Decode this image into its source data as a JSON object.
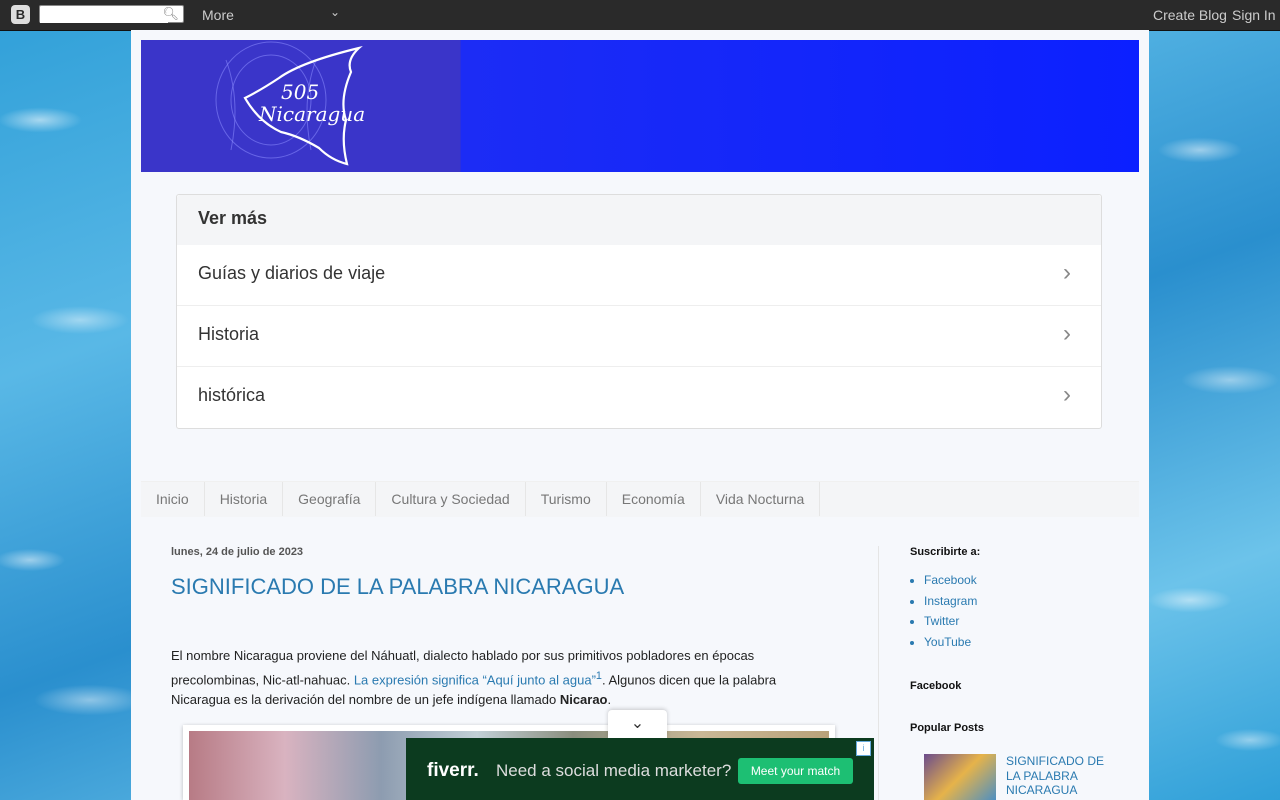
{
  "navbar": {
    "logo_letter": "B",
    "search_placeholder": "",
    "more_label": "More",
    "create_blog": "Create Blog",
    "sign_in": "Sign In"
  },
  "banner": {
    "line1": "505",
    "line2": "Nicaragua",
    "colors": {
      "left": "#3a35c9",
      "right": "#0b20ff"
    }
  },
  "ver_mas": {
    "title": "Ver más",
    "items": [
      {
        "label": "Guías y diarios de viaje"
      },
      {
        "label": "Historia"
      },
      {
        "label": "histórica"
      }
    ]
  },
  "tabs": [
    {
      "label": "Inicio"
    },
    {
      "label": "Historia"
    },
    {
      "label": "Geografía"
    },
    {
      "label": "Cultura y Sociedad"
    },
    {
      "label": "Turismo"
    },
    {
      "label": "Economía"
    },
    {
      "label": "Vida Nocturna"
    }
  ],
  "post": {
    "date": "lunes, 24 de julio de 2023",
    "title": "SIGNIFICADO DE LA PALABRA NICARAGUA",
    "body_part1": " El nombre Nicaragua proviene del Náhuatl, dialecto hablado por sus primitivos pobladores en épocas precolombinas, Nic-atl-nahuac. ",
    "body_link": "La expresión significa “Aquí junto al agua”",
    "body_sup": "1",
    "body_part2": ". Algunos dicen que la palabra Nicaragua es la derivación del nombre de un jefe indígena llamado ",
    "body_bold": "Nicarao",
    "body_end": "."
  },
  "sidebar": {
    "subscribe_title": "Suscribirte a:",
    "subscribe_links": [
      "Facebook",
      "Instagram",
      "Twitter",
      "YouTube"
    ],
    "facebook_title": "Facebook",
    "popular_title": "Popular Posts",
    "popular_post_title": "SIGNIFICADO DE LA PALABRA NICARAGUA"
  },
  "ad": {
    "brand": "fiverr.",
    "text": "Need a social media marketer?",
    "button": "Meet your match",
    "info": "i"
  }
}
